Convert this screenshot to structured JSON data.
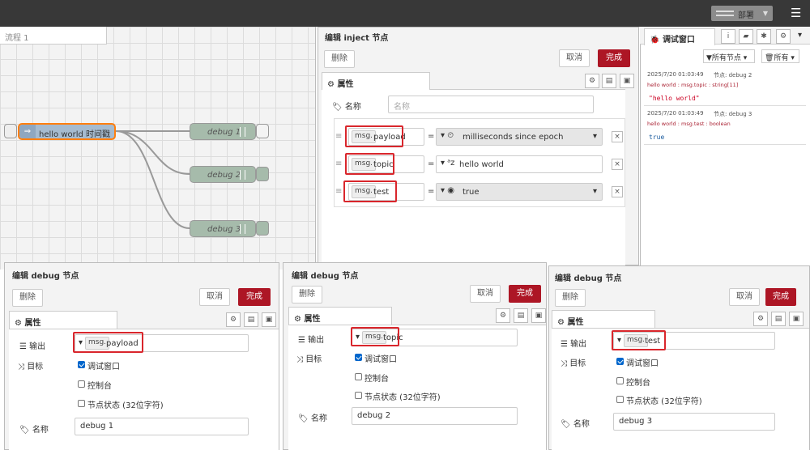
{
  "topbar": {
    "deploy_label": "部署",
    "menu_icon": "hamburger-icon"
  },
  "flow": {
    "tab_label": "流程 1",
    "inject_label": "hello world 时间戳",
    "debug_nodes": [
      "debug 1",
      "debug 2",
      "debug 3"
    ]
  },
  "inject_editor": {
    "title": "编辑 inject 节点",
    "delete": "删除",
    "cancel": "取消",
    "done": "完成",
    "tab": "属性",
    "name_label": "名称",
    "name_placeholder": "名称",
    "props": [
      {
        "prefix": "msg.",
        "key": "payload",
        "value": "milliseconds since epoch",
        "type": "timestamp"
      },
      {
        "prefix": "msg.",
        "key": "topic",
        "value": "hello world",
        "type": "string"
      },
      {
        "prefix": "msg.",
        "key": "test",
        "value": "true",
        "type": "boolean"
      }
    ]
  },
  "debug_panel": {
    "tab": "调试窗口",
    "filter_label": "所有节点",
    "clear_label": "所有",
    "messages": [
      {
        "time": "2025/7/20 01:03:49",
        "node": "节点: debug 2",
        "meta": "hello world : msg.topic : string[11]",
        "value": "\"hello world\""
      },
      {
        "time": "2025/7/20 01:03:49",
        "node": "节点: debug 3",
        "meta": "hello world : msg.test : boolean",
        "value": "true"
      }
    ]
  },
  "debug_editors": [
    {
      "title": "编辑 debug 节点",
      "delete": "删除",
      "cancel": "取消",
      "done": "完成",
      "tab": "属性",
      "output_label": "输出",
      "output_prefix": "msg.",
      "output_key": "payload",
      "target_label": "目标",
      "opt1": "调试窗口",
      "opt2": "控制台",
      "opt3": "节点状态 (32位字符)",
      "name_label": "名称",
      "name_value": "debug 1"
    },
    {
      "title": "编辑 debug 节点",
      "delete": "删除",
      "cancel": "取消",
      "done": "完成",
      "tab": "属性",
      "output_label": "输出",
      "output_prefix": "msg.",
      "output_key": "topic",
      "target_label": "目标",
      "opt1": "调试窗口",
      "opt2": "控制台",
      "opt3": "节点状态 (32位字符)",
      "name_label": "名称",
      "name_value": "debug 2"
    },
    {
      "title": "编辑 debug 节点",
      "delete": "删除",
      "cancel": "取消",
      "done": "完成",
      "tab": "属性",
      "output_label": "输出",
      "output_prefix": "msg.",
      "output_key": "test",
      "target_label": "目标",
      "opt1": "调试窗口",
      "opt2": "控制台",
      "opt3": "节点状态 (32位字符)",
      "name_label": "名称",
      "name_value": "debug 3"
    }
  ]
}
